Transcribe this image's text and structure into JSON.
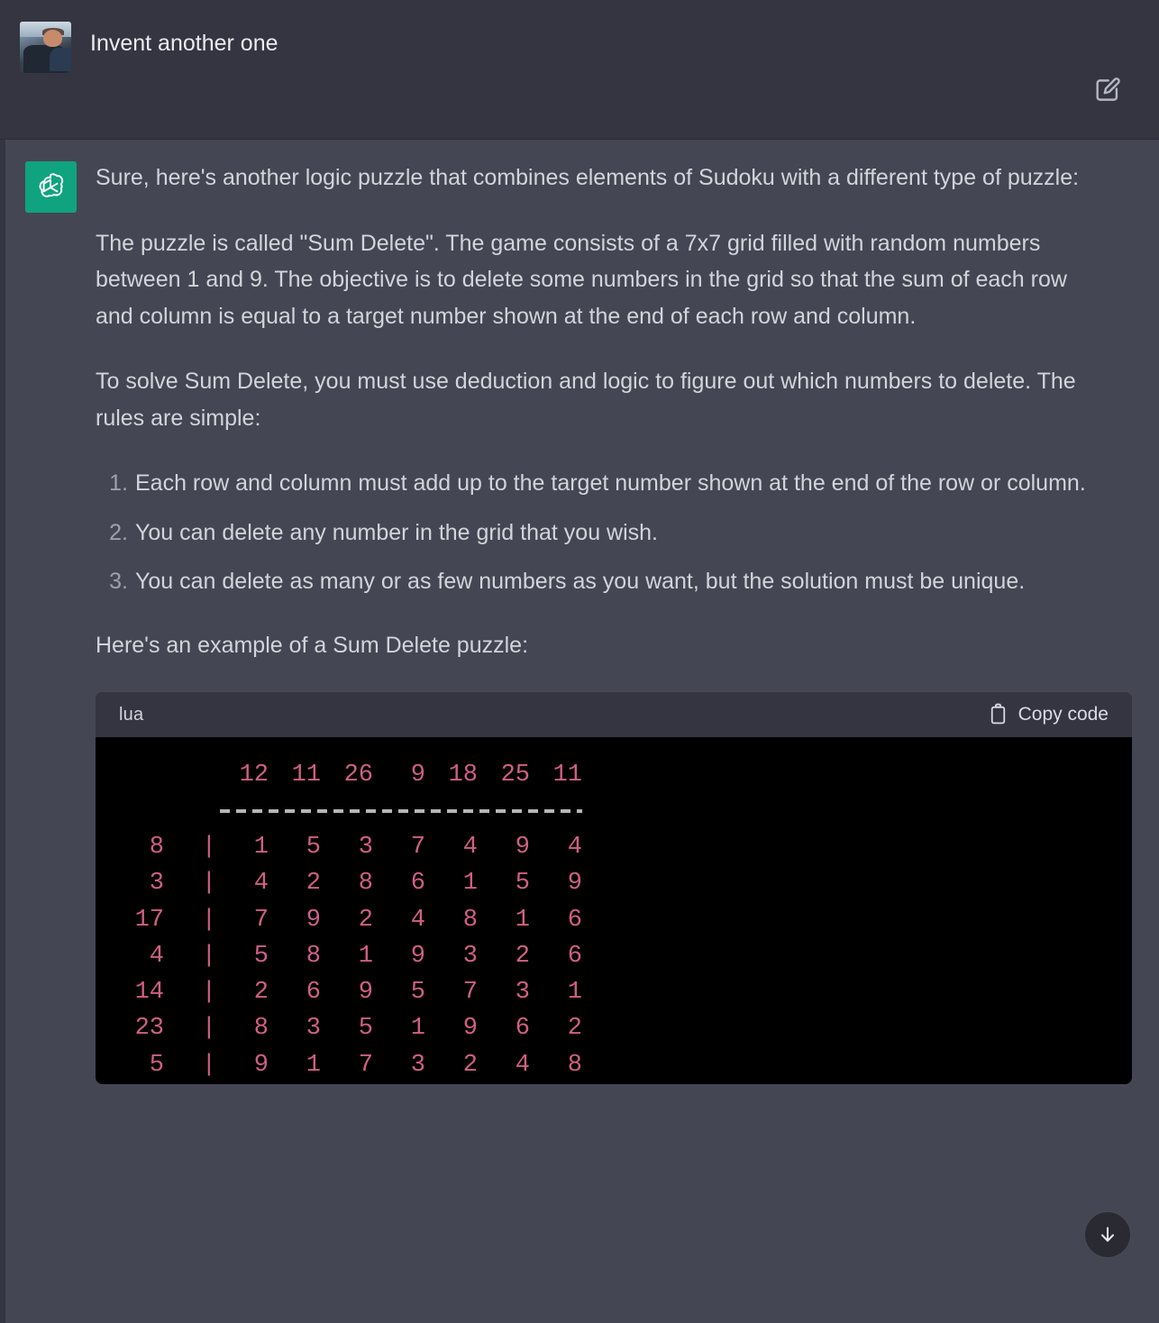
{
  "user_message": {
    "text": "Invent another one",
    "avatar": "user-photo-avatar",
    "edit_icon": "edit-pencil-square-icon"
  },
  "assistant_message": {
    "avatar": "chatgpt-logo-icon",
    "paragraphs": [
      "Sure, here's another logic puzzle that combines elements of Sudoku with a different type of puzzle:",
      "The puzzle is called \"Sum Delete\". The game consists of a 7x7 grid filled with random numbers between 1 and 9. The objective is to delete some numbers in the grid so that the sum of each row and column is equal to a target number shown at the end of each row and column.",
      "To solve Sum Delete, you must use deduction and logic to figure out which numbers to delete. The rules are simple:"
    ],
    "rules": [
      "Each row and column must add up to the target number shown at the end of the row or column.",
      "You can delete any number in the grid that you wish.",
      "You can delete as many or as few numbers as you want, but the solution must be unique."
    ],
    "closing_paragraph": "Here's an example of a Sum Delete puzzle:"
  },
  "code_block": {
    "language": "lua",
    "copy_label": "Copy code",
    "copy_icon": "clipboard-icon",
    "separator_bar": "|"
  },
  "chart_data": {
    "type": "table",
    "title": "Sum Delete puzzle example",
    "column_targets": [
      12,
      11,
      26,
      9,
      18,
      25,
      11
    ],
    "row_targets": [
      8,
      3,
      17,
      4,
      14,
      23,
      5
    ],
    "grid": [
      [
        1,
        5,
        3,
        7,
        4,
        9,
        4
      ],
      [
        4,
        2,
        8,
        6,
        1,
        5,
        9
      ],
      [
        7,
        9,
        2,
        4,
        8,
        1,
        6
      ],
      [
        5,
        8,
        1,
        9,
        3,
        2,
        6
      ],
      [
        2,
        6,
        9,
        5,
        7,
        3,
        1
      ],
      [
        8,
        3,
        5,
        1,
        9,
        6,
        2
      ],
      [
        9,
        1,
        7,
        3,
        2,
        4,
        8
      ]
    ],
    "number_color": "#cf5f87",
    "background_color": "#000000"
  },
  "scroll_button": {
    "icon": "arrow-down-icon"
  }
}
